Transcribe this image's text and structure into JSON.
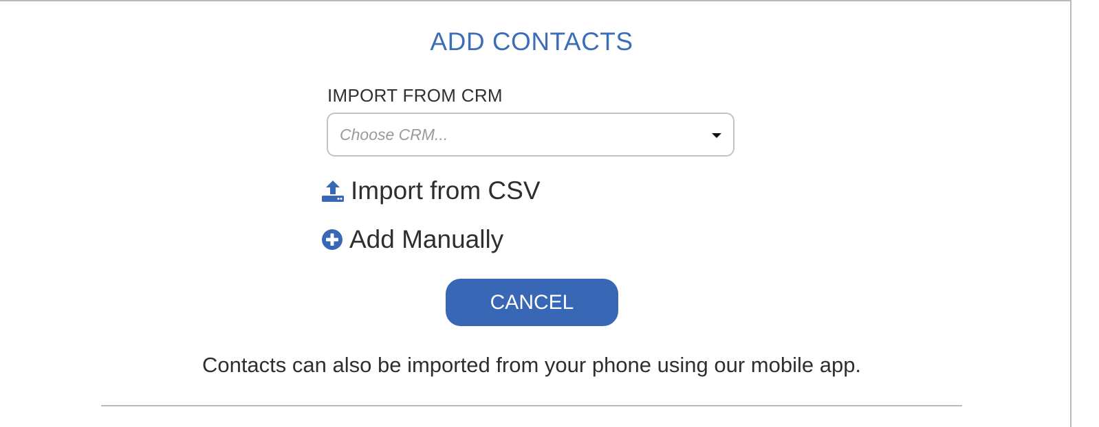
{
  "dialog": {
    "title": "ADD CONTACTS",
    "crm": {
      "label": "IMPORT FROM CRM",
      "placeholder": "Choose CRM...",
      "caret_icon": "caret-down-icon"
    },
    "actions": {
      "csv": {
        "label": "Import from CSV",
        "icon": "upload-icon"
      },
      "manual": {
        "label": "Add Manually",
        "icon": "plus-circle-icon"
      }
    },
    "cancel_label": "CANCEL",
    "note": "Contacts can also be imported from your phone using our mobile app."
  },
  "colors": {
    "accent": "#3867b5",
    "title": "#3c6db8",
    "border": "#c2c2c2"
  }
}
